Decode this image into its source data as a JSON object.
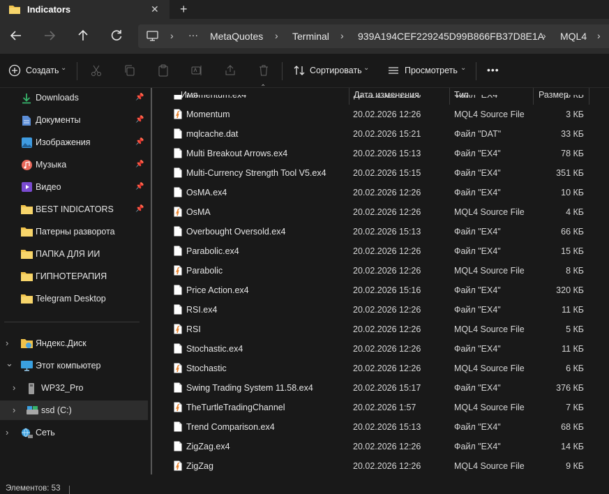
{
  "tab": {
    "title": "Indicators",
    "close": "✕",
    "new_tab": "+"
  },
  "breadcrumbs": {
    "more": "···",
    "items": [
      "MetaQuotes",
      "Terminal",
      "939A194CEF229245D99B866FB37D8E1A",
      "MQL4"
    ]
  },
  "toolbar": {
    "create_label": "Создать",
    "sort_label": "Сортировать",
    "view_label": "Просмотреть",
    "more_label": "•••"
  },
  "sidebar": {
    "quick": [
      {
        "label": "Downloads",
        "icon": "download-icon",
        "pinned": true
      },
      {
        "label": "Документы",
        "icon": "document-icon",
        "pinned": true
      },
      {
        "label": "Изображения",
        "icon": "pictures-icon",
        "pinned": true
      },
      {
        "label": "Музыка",
        "icon": "music-icon",
        "pinned": true
      },
      {
        "label": "Видео",
        "icon": "video-icon",
        "pinned": true
      },
      {
        "label": "BEST INDICATORS",
        "icon": "folder-icon",
        "pinned": true
      },
      {
        "label": "Патерны разворота",
        "icon": "folder-icon",
        "pinned": false
      },
      {
        "label": "ПАПКА ДЛЯ ИИ",
        "icon": "folder-icon",
        "pinned": false
      },
      {
        "label": "ГИПНОТЕРАПИЯ",
        "icon": "folder-icon",
        "pinned": false
      },
      {
        "label": "Telegram Desktop",
        "icon": "folder-icon",
        "pinned": false
      }
    ],
    "tree": [
      {
        "label": "Яндекс.Диск",
        "icon": "yandex-disk-icon",
        "chevron": "›"
      },
      {
        "label": "Этот компьютер",
        "icon": "computer-icon",
        "chevron": "⌄"
      },
      {
        "label": "WP32_Pro",
        "icon": "usb-drive-icon",
        "chevron": "›"
      },
      {
        "label": "ssd (C:)",
        "icon": "system-drive-icon",
        "chevron": "›"
      },
      {
        "label": "Сеть",
        "icon": "network-icon",
        "chevron": "›"
      }
    ]
  },
  "columns": {
    "name": "Имя",
    "date": "Дата изменения",
    "type": "Тип",
    "size": "Размер"
  },
  "files": [
    {
      "name": "Momentum.ex4",
      "date": "20.02.2026 12:26",
      "type": "Файл \"EX4\"",
      "size": "8 КБ",
      "kind": "ex4"
    },
    {
      "name": "Momentum",
      "date": "20.02.2026 12:26",
      "type": "MQL4 Source File",
      "size": "3 КБ",
      "kind": "mq4"
    },
    {
      "name": "mqlcache.dat",
      "date": "20.02.2026 15:21",
      "type": "Файл \"DAT\"",
      "size": "33 КБ",
      "kind": "ex4"
    },
    {
      "name": "Multi Breakout Arrows.ex4",
      "date": "20.02.2026 15:13",
      "type": "Файл \"EX4\"",
      "size": "78 КБ",
      "kind": "ex4"
    },
    {
      "name": "Multi-Currency Strength Tool V5.ex4",
      "date": "20.02.2026 15:15",
      "type": "Файл \"EX4\"",
      "size": "351 КБ",
      "kind": "ex4"
    },
    {
      "name": "OsMA.ex4",
      "date": "20.02.2026 12:26",
      "type": "Файл \"EX4\"",
      "size": "10 КБ",
      "kind": "ex4"
    },
    {
      "name": "OsMA",
      "date": "20.02.2026 12:26",
      "type": "MQL4 Source File",
      "size": "4 КБ",
      "kind": "mq4"
    },
    {
      "name": "Overbought Oversold.ex4",
      "date": "20.02.2026 15:13",
      "type": "Файл \"EX4\"",
      "size": "66 КБ",
      "kind": "ex4"
    },
    {
      "name": "Parabolic.ex4",
      "date": "20.02.2026 12:26",
      "type": "Файл \"EX4\"",
      "size": "15 КБ",
      "kind": "ex4"
    },
    {
      "name": "Parabolic",
      "date": "20.02.2026 12:26",
      "type": "MQL4 Source File",
      "size": "8 КБ",
      "kind": "mq4"
    },
    {
      "name": "Price Action.ex4",
      "date": "20.02.2026 15:16",
      "type": "Файл \"EX4\"",
      "size": "320 КБ",
      "kind": "ex4"
    },
    {
      "name": "RSI.ex4",
      "date": "20.02.2026 12:26",
      "type": "Файл \"EX4\"",
      "size": "11 КБ",
      "kind": "ex4"
    },
    {
      "name": "RSI",
      "date": "20.02.2026 12:26",
      "type": "MQL4 Source File",
      "size": "5 КБ",
      "kind": "mq4"
    },
    {
      "name": "Stochastic.ex4",
      "date": "20.02.2026 12:26",
      "type": "Файл \"EX4\"",
      "size": "11 КБ",
      "kind": "ex4"
    },
    {
      "name": "Stochastic",
      "date": "20.02.2026 12:26",
      "type": "MQL4 Source File",
      "size": "6 КБ",
      "kind": "mq4"
    },
    {
      "name": "Swing Trading System 11.58.ex4",
      "date": "20.02.2026 15:17",
      "type": "Файл \"EX4\"",
      "size": "376 КБ",
      "kind": "ex4"
    },
    {
      "name": "TheTurtleTradingChannel",
      "date": "20.02.2026 1:57",
      "type": "MQL4 Source File",
      "size": "7 КБ",
      "kind": "mq4"
    },
    {
      "name": "Trend Comparison.ex4",
      "date": "20.02.2026 15:13",
      "type": "Файл \"EX4\"",
      "size": "68 КБ",
      "kind": "ex4"
    },
    {
      "name": "ZigZag.ex4",
      "date": "20.02.2026 12:26",
      "type": "Файл \"EX4\"",
      "size": "14 КБ",
      "kind": "ex4"
    },
    {
      "name": "ZigZag",
      "date": "20.02.2026 12:26",
      "type": "MQL4 Source File",
      "size": "9 КБ",
      "kind": "mq4"
    }
  ],
  "status": {
    "items_text": "Элементов: 53"
  },
  "colors": {
    "folder": "#f0c24b",
    "mq4_accent": "#e8822b",
    "accent_blue": "#4aa3df"
  }
}
